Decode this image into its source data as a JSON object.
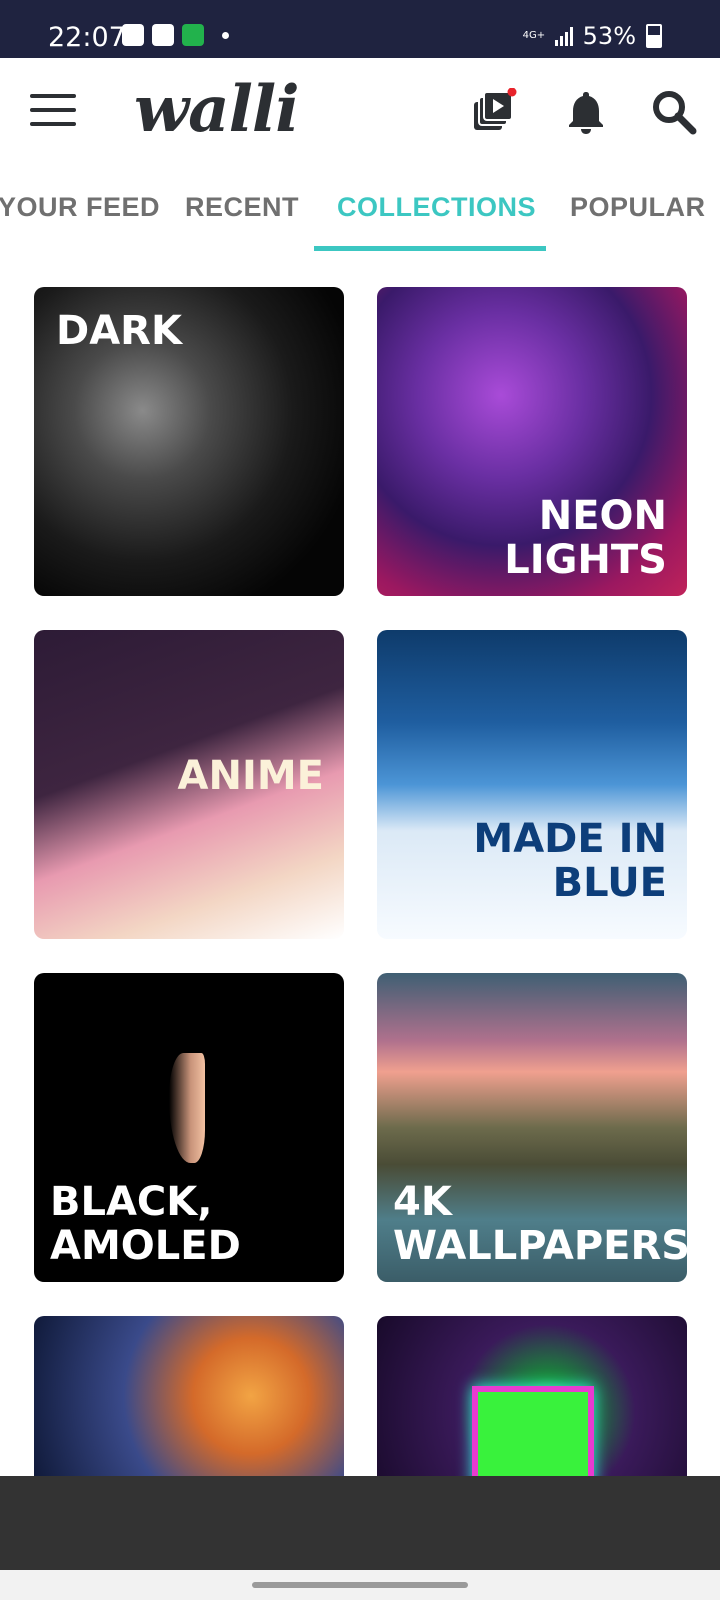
{
  "status_bar": {
    "time": "22:07",
    "network": "4G+",
    "battery": "53%"
  },
  "header": {
    "logo": "walli",
    "icons": [
      "menu-icon",
      "video-wallpaper-icon",
      "bell-icon",
      "search-icon"
    ]
  },
  "tabs": [
    {
      "label": "YOUR FEED",
      "active": false
    },
    {
      "label": "RECENT",
      "active": false
    },
    {
      "label": "COLLECTIONS",
      "active": true
    },
    {
      "label": "POPULAR",
      "active": false
    }
  ],
  "accent_color": "#3cc7c2",
  "collections": [
    {
      "title": "DARK"
    },
    {
      "title": "NEON\nLIGHTS"
    },
    {
      "title": "ANIME"
    },
    {
      "title": "MADE IN\nBLUE"
    },
    {
      "title": "BLACK,\nAMOLED"
    },
    {
      "title": "4K\nWALLPAPERS"
    },
    {
      "title": ""
    },
    {
      "title": ""
    }
  ]
}
